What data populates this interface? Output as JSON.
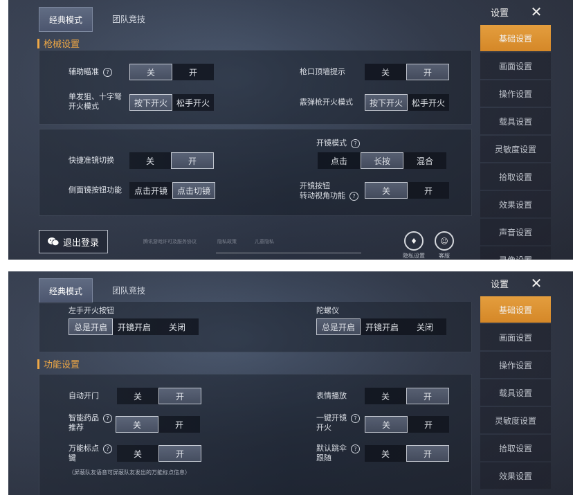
{
  "tabs": [
    "经典模式",
    "团队竞技"
  ],
  "sidebar": {
    "title": "设置",
    "items": [
      "基础设置",
      "画面设置",
      "操作设置",
      "载具设置",
      "灵敏度设置",
      "拾取设置",
      "效果设置",
      "声音设置",
      "录像设置"
    ]
  },
  "panel1": {
    "section": "枪械设置",
    "aim_assist": {
      "label": "辅助瞄准",
      "options": [
        "关",
        "开"
      ],
      "selected": "关"
    },
    "muzzle_hint": {
      "label": "枪口顶墙提示",
      "options": [
        "关",
        "开"
      ],
      "selected": "开"
    },
    "sniper_fire_mode": {
      "label": "单发狙、十字弩开火模式",
      "label_line1": "单发狙、十字弩",
      "label_line2": "开火模式",
      "options": [
        "按下开火",
        "松手开火"
      ],
      "selected": "按下开火"
    },
    "shotgun_fire_mode": {
      "label": "霰弹枪开火模式",
      "options": [
        "按下开火",
        "松手开火"
      ],
      "selected": "按下开火"
    },
    "quick_scope": {
      "label": "快捷准镜切换",
      "options": [
        "关",
        "开"
      ],
      "selected": "开"
    },
    "scope_mode": {
      "label": "开镜模式",
      "options": [
        "点击",
        "长按",
        "混合"
      ],
      "selected": "长按"
    },
    "side_scope": {
      "label": "侧面镜按钮功能",
      "options": [
        "点击开镜",
        "点击切镜"
      ],
      "selected": "点击切镜"
    },
    "scope_turn": {
      "label_line1": "开镜按钮",
      "label_line2": "转动视角功能",
      "options": [
        "关",
        "开"
      ],
      "selected": "关"
    },
    "logout": "退出登录",
    "faded_texts": [
      "腾讯游戏许可及服务协议",
      "隐私政策",
      "儿童隐私"
    ],
    "bottom_buttons": [
      "隐私设置",
      "客服"
    ]
  },
  "panel2": {
    "left_fire_button": {
      "label": "左手开火按钮",
      "options": [
        "总是开启",
        "开镜开启",
        "关闭"
      ],
      "selected": "总是开启"
    },
    "gyroscope": {
      "label": "陀螺仪",
      "options": [
        "总是开启",
        "开镜开启",
        "关闭"
      ],
      "selected": "总是开启"
    },
    "section": "功能设置",
    "auto_door": {
      "label": "自动开门",
      "options": [
        "关",
        "开"
      ],
      "selected": "开"
    },
    "emote_play": {
      "label": "表情播放",
      "options": [
        "关",
        "开"
      ],
      "selected": "开"
    },
    "smart_meds": {
      "label_line1": "智能药品",
      "label_line2": "推荐",
      "options": [
        "关",
        "开"
      ],
      "selected": "关"
    },
    "one_key_scope": {
      "label_line1": "一键开镜",
      "label_line2": "开火",
      "options": [
        "关",
        "开"
      ],
      "selected": "关"
    },
    "universal_mark": {
      "label_line1": "万能标点",
      "label_line2": "键",
      "options": [
        "关",
        "开"
      ],
      "selected": "开"
    },
    "default_follow": {
      "label_line1": "默认跳伞",
      "label_line2": "跟随",
      "options": [
        "关",
        "开"
      ],
      "selected": "开"
    },
    "mark_note": "（屏蔽队友语音可屏蔽队友发出的万能标点信息）"
  }
}
